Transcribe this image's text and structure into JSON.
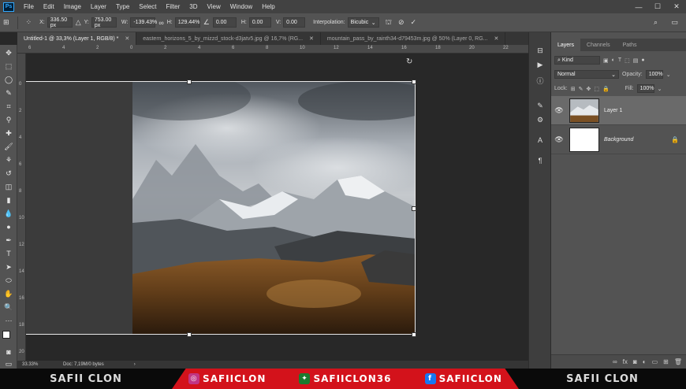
{
  "app": {
    "logo": "Ps"
  },
  "menu": [
    "File",
    "Edit",
    "Image",
    "Layer",
    "Type",
    "Select",
    "Filter",
    "3D",
    "View",
    "Window",
    "Help"
  ],
  "window_controls": {
    "minimize": "—",
    "maximize": "☐",
    "close": "✕"
  },
  "options": {
    "x_label": "X:",
    "x_value": "336.50 px",
    "y_label": "Y:",
    "y_value": "753.00 px",
    "w_label": "W:",
    "w_value": "-139.43%",
    "h_label": "H:",
    "h_value": "129.44%",
    "angle_value": "0.00",
    "hskew_label": "H:",
    "hskew_value": "0.00",
    "vskew_label": "V:",
    "vskew_value": "0.00",
    "interp_label": "Interpolation:",
    "interp_value": "Bicubic"
  },
  "tabs": [
    {
      "label": "Untitled-1 @ 33,3% (Layer 1, RGB/8) *",
      "active": true
    },
    {
      "label": "eastern_horizons_5_by_mizzd_stock-d3jatv5.jpg @ 16,7% (RG...",
      "active": false
    },
    {
      "label": "mountain_pass_by_rainth34-d79453m.jpg @ 50% (Layer 0, RG...",
      "active": false
    }
  ],
  "ruler_top": [
    "6",
    "4",
    "2",
    "0",
    "2",
    "4",
    "6",
    "8",
    "10",
    "12",
    "14",
    "16",
    "18",
    "20",
    "22"
  ],
  "ruler_left": [
    "0",
    "2",
    "4",
    "6",
    "8",
    "10",
    "12",
    "14",
    "16",
    "18",
    "20"
  ],
  "status": {
    "zoom": "33.33%",
    "doc": "Doc: 7,19M/0 bytes"
  },
  "panel": {
    "tabs": [
      "Layers",
      "Channels",
      "Paths"
    ],
    "kind_placeholder": "Kind",
    "blend_mode": "Normal",
    "opacity_label": "Opacity:",
    "opacity_value": "100%",
    "lock_label": "Lock:",
    "fill_label": "Fill:",
    "fill_value": "100%",
    "layers": [
      {
        "name": "Layer 1"
      },
      {
        "name": "Background"
      }
    ]
  },
  "banner": {
    "left": "SAFII CLON",
    "right": "SAFII CLON",
    "socials": [
      {
        "icon": "instagram-icon",
        "label": "SAFIICLON"
      },
      {
        "icon": "green-logo-icon",
        "label": "SAFIICLON36"
      },
      {
        "icon": "facebook-icon",
        "label": "SAFIICLON"
      }
    ]
  },
  "colors": {
    "accent": "#31a8ff",
    "banner_red": "#d3121b",
    "panel_bg": "#535353",
    "canvas_bg": "#282828"
  }
}
